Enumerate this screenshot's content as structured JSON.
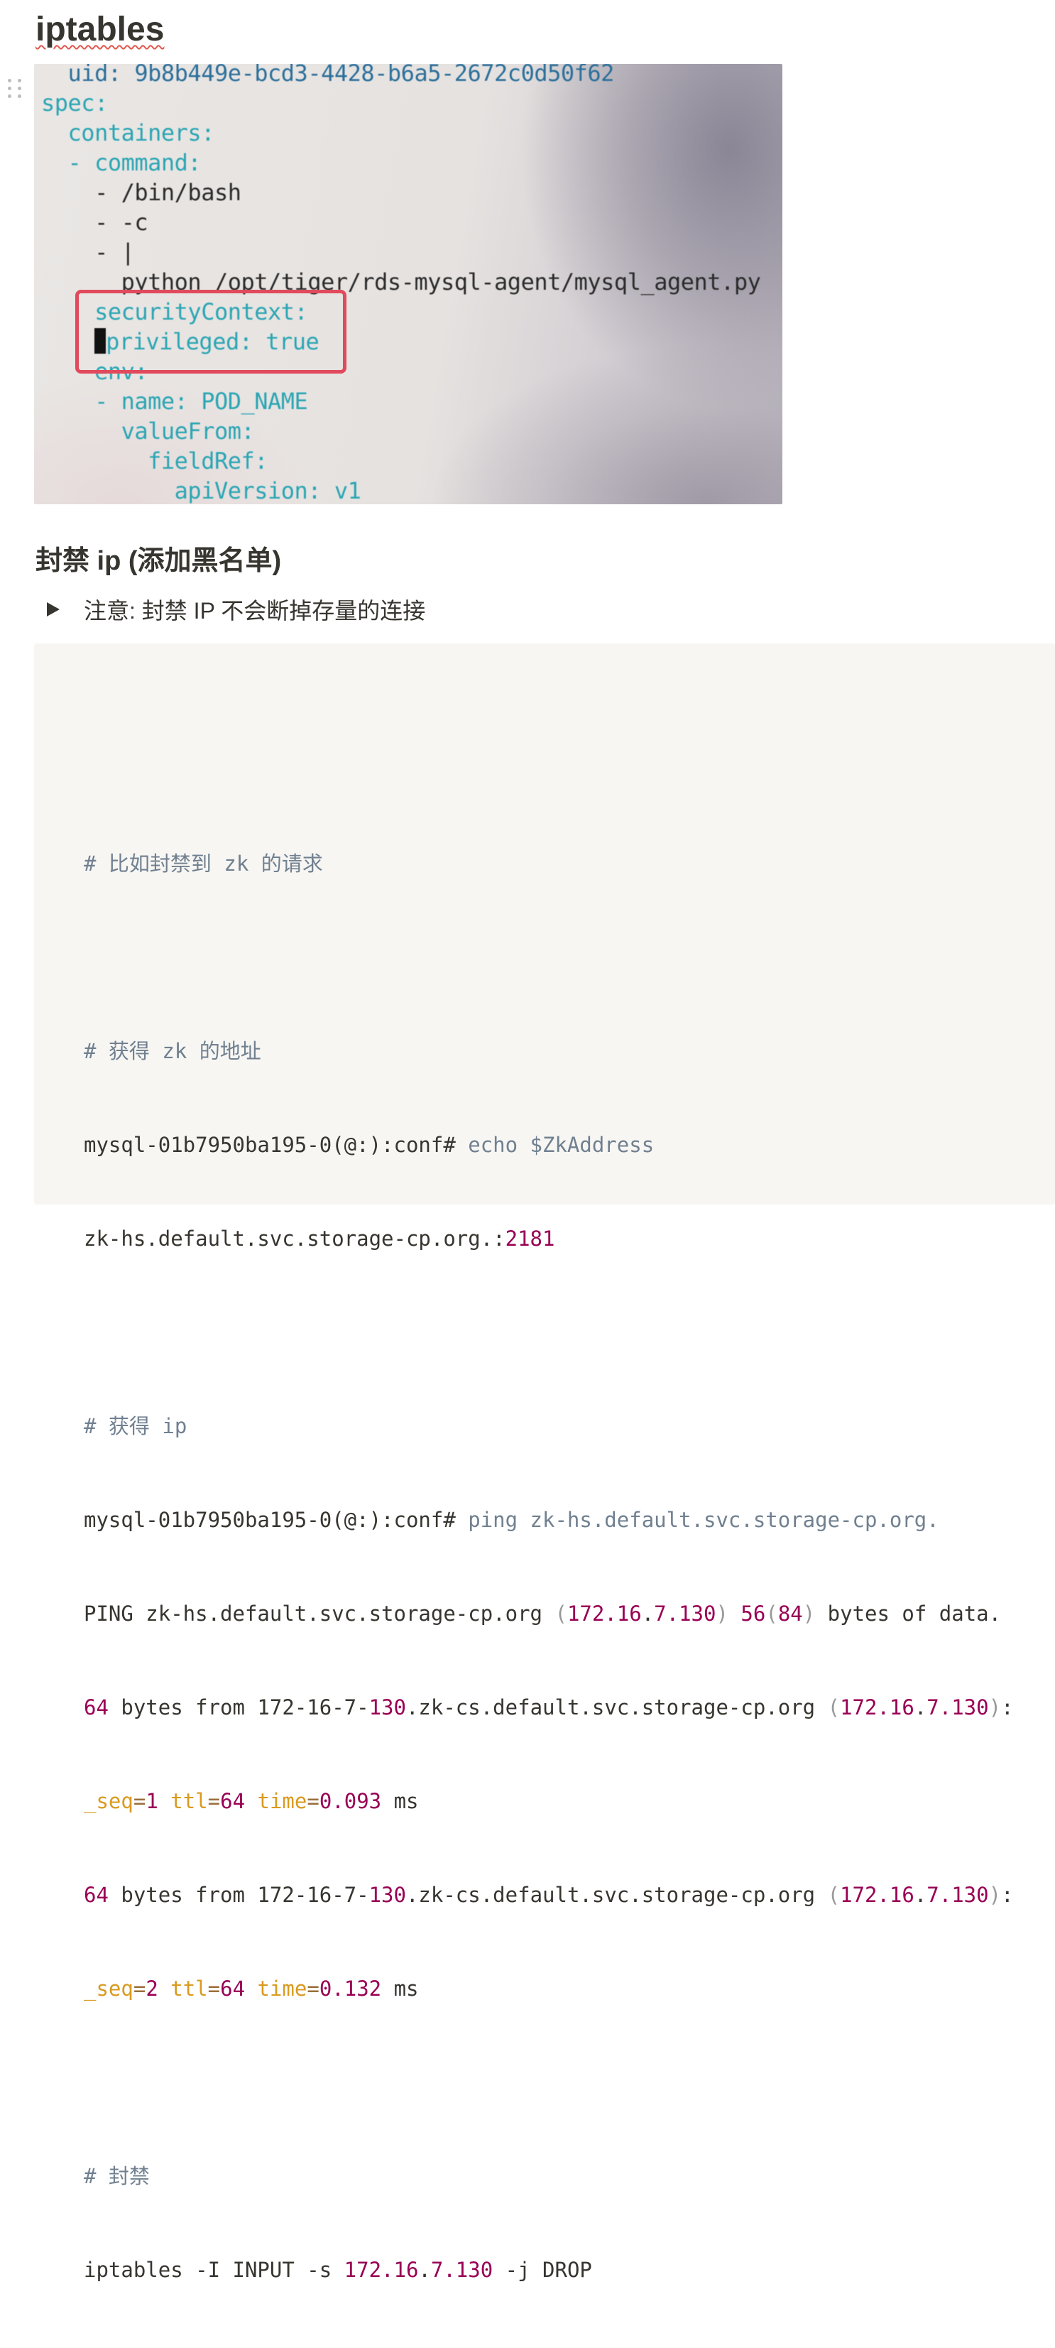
{
  "page": {
    "title": "iptables"
  },
  "image": {
    "lines": [
      "uid: 9b8b449e-bcd3-4428-b6a5-2672c0d50f62",
      "spec:",
      "containers:",
      "- command:",
      "- /bin/bash",
      "- -c",
      "- |",
      "python /opt/tiger/rds-mysql-agent/mysql_agent.py",
      "securityContext:",
      "privileged: true",
      "env:",
      "- name: POD_NAME",
      "valueFrom:",
      "fieldRef:",
      "apiVersion: v1"
    ]
  },
  "section": {
    "heading": "封禁 ip (添加黑名单)",
    "toggle_label": "注意: 封禁 IP 不会断掉存量的连接"
  },
  "code": {
    "comment_1": "# 比如封禁到 zk 的请求",
    "comment_2": "# 获得 zk 的地址",
    "prompt": "mysql-01b7950ba195-0(@:):conf#",
    "cmd_echo": " echo $ZkAddress",
    "zk_address": "zk-hs.default.svc.storage-cp.org.:2181",
    "comment_3": "# 获得 ip",
    "cmd_ping": " ping zk-hs.default.svc.storage-cp.org.",
    "ping_header": "PING zk-hs.default.svc.storage-cp.org (172.16.7.130) 56(84) bytes of data.",
    "reply_1": "64 bytes from 172-16-7-130.zk-cs.default.svc.storage-cp.org (172.16.7.130):",
    "reply_1_cont": "_seq=1 ttl=64 time=0.093 ms",
    "reply_2": "64 bytes from 172-16-7-130.zk-cs.default.svc.storage-cp.org (172.16.7.130):",
    "reply_2_cont": "_seq=2 ttl=64 time=0.132 ms",
    "comment_4": "# 封禁",
    "iptables_cmd": "iptables -I INPUT -s 172.16.7.130 -j DROP"
  },
  "colors": {
    "code_background": "#f7f6f3",
    "comment": "#708090",
    "number": "#990055",
    "attribute": "#d99a1f",
    "highlight_border": "#e04a5c"
  }
}
